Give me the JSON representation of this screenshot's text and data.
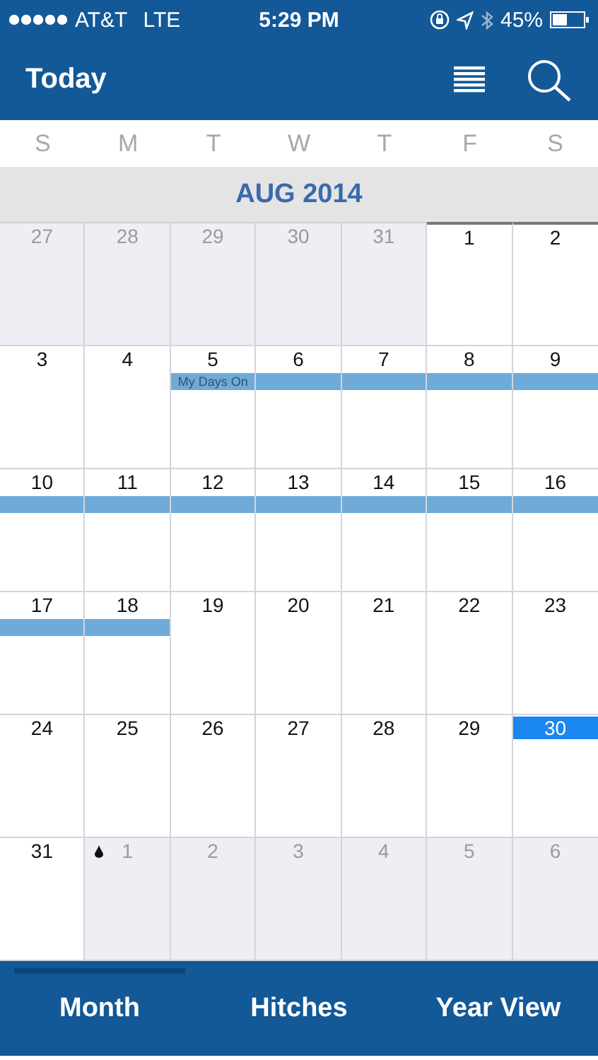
{
  "status_bar": {
    "carrier": "AT&T",
    "network": "LTE",
    "time": "5:29 PM",
    "battery": "45%"
  },
  "header": {
    "today_button": "Today"
  },
  "weekdays": [
    "S",
    "M",
    "T",
    "W",
    "T",
    "F",
    "S"
  ],
  "month_title": "AUG 2014",
  "weeks": [
    {
      "days": [
        {
          "day": "27",
          "in_month": false,
          "today": false,
          "band": false
        },
        {
          "day": "28",
          "in_month": false,
          "today": false,
          "band": false
        },
        {
          "day": "29",
          "in_month": false,
          "today": false,
          "band": false
        },
        {
          "day": "30",
          "in_month": false,
          "today": false,
          "band": false
        },
        {
          "day": "31",
          "in_month": false,
          "today": false,
          "band": false
        },
        {
          "day": "1",
          "in_month": true,
          "today": false,
          "band": false
        },
        {
          "day": "2",
          "in_month": true,
          "today": false,
          "band": false
        }
      ]
    },
    {
      "days": [
        {
          "day": "3",
          "in_month": true,
          "today": false,
          "band": false
        },
        {
          "day": "4",
          "in_month": true,
          "today": false,
          "band": false
        },
        {
          "day": "5",
          "in_month": true,
          "today": false,
          "band": true,
          "event_label": "My Days On"
        },
        {
          "day": "6",
          "in_month": true,
          "today": false,
          "band": true
        },
        {
          "day": "7",
          "in_month": true,
          "today": false,
          "band": true
        },
        {
          "day": "8",
          "in_month": true,
          "today": false,
          "band": true
        },
        {
          "day": "9",
          "in_month": true,
          "today": false,
          "band": true
        }
      ]
    },
    {
      "days": [
        {
          "day": "10",
          "in_month": true,
          "today": false,
          "band": true
        },
        {
          "day": "11",
          "in_month": true,
          "today": false,
          "band": true
        },
        {
          "day": "12",
          "in_month": true,
          "today": false,
          "band": true
        },
        {
          "day": "13",
          "in_month": true,
          "today": false,
          "band": true
        },
        {
          "day": "14",
          "in_month": true,
          "today": false,
          "band": true
        },
        {
          "day": "15",
          "in_month": true,
          "today": false,
          "band": true
        },
        {
          "day": "16",
          "in_month": true,
          "today": false,
          "band": true
        }
      ]
    },
    {
      "days": [
        {
          "day": "17",
          "in_month": true,
          "today": false,
          "band": true
        },
        {
          "day": "18",
          "in_month": true,
          "today": false,
          "band": true
        },
        {
          "day": "19",
          "in_month": true,
          "today": false,
          "band": false
        },
        {
          "day": "20",
          "in_month": true,
          "today": false,
          "band": false
        },
        {
          "day": "21",
          "in_month": true,
          "today": false,
          "band": false
        },
        {
          "day": "22",
          "in_month": true,
          "today": false,
          "band": false
        },
        {
          "day": "23",
          "in_month": true,
          "today": false,
          "band": false
        }
      ]
    },
    {
      "days": [
        {
          "day": "24",
          "in_month": true,
          "today": false,
          "band": false
        },
        {
          "day": "25",
          "in_month": true,
          "today": false,
          "band": false
        },
        {
          "day": "26",
          "in_month": true,
          "today": false,
          "band": false
        },
        {
          "day": "27",
          "in_month": true,
          "today": false,
          "band": false
        },
        {
          "day": "28",
          "in_month": true,
          "today": false,
          "band": false
        },
        {
          "day": "29",
          "in_month": true,
          "today": false,
          "band": false
        },
        {
          "day": "30",
          "in_month": true,
          "today": true,
          "band": false
        }
      ]
    },
    {
      "days": [
        {
          "day": "31",
          "in_month": true,
          "today": false,
          "band": false
        },
        {
          "day": "1",
          "in_month": false,
          "today": false,
          "band": false,
          "drop": true
        },
        {
          "day": "2",
          "in_month": false,
          "today": false,
          "band": false
        },
        {
          "day": "3",
          "in_month": false,
          "today": false,
          "band": false
        },
        {
          "day": "4",
          "in_month": false,
          "today": false,
          "band": false
        },
        {
          "day": "5",
          "in_month": false,
          "today": false,
          "band": false
        },
        {
          "day": "6",
          "in_month": false,
          "today": false,
          "band": false
        }
      ]
    }
  ],
  "tabs": [
    {
      "label": "Month",
      "selected": true
    },
    {
      "label": "Hitches",
      "selected": false
    },
    {
      "label": "Year View",
      "selected": false
    }
  ]
}
